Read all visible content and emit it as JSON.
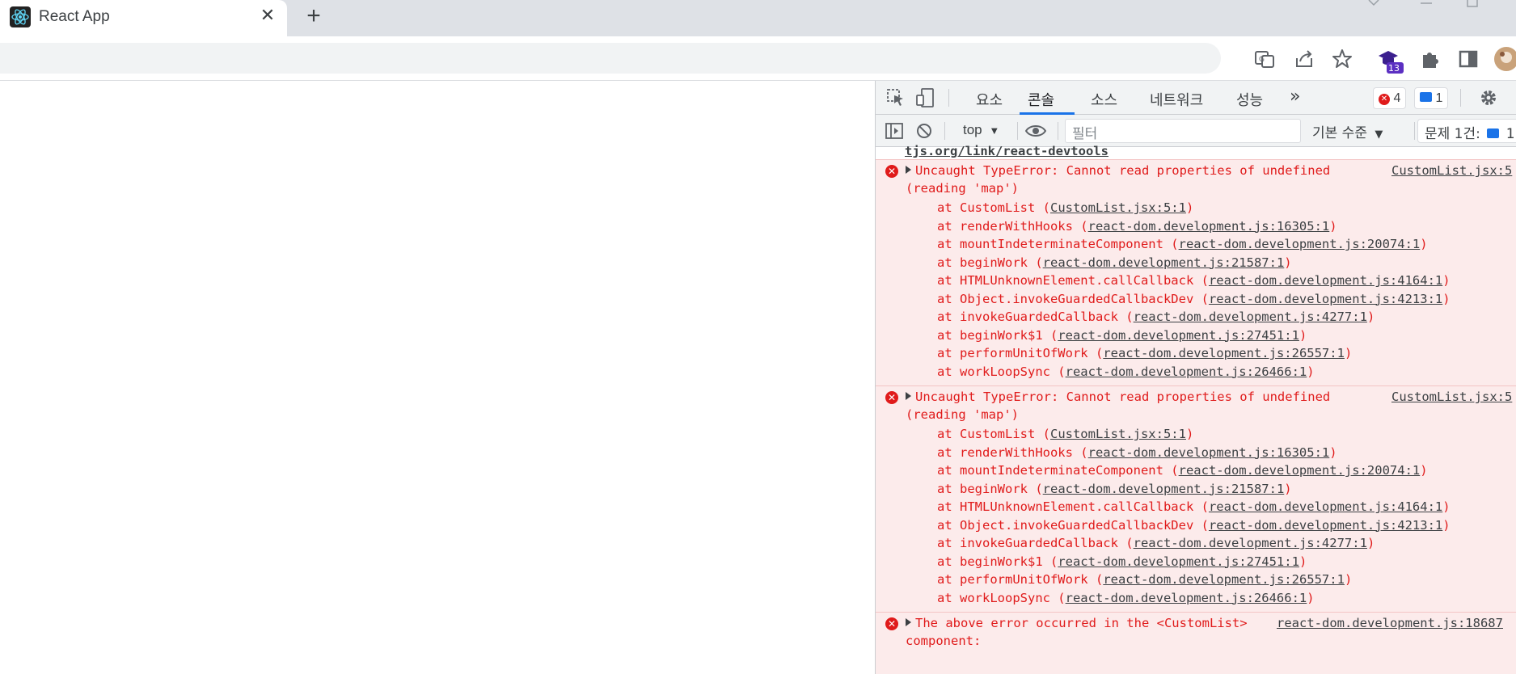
{
  "browser": {
    "tab_title": "React App",
    "new_tab_label": "+",
    "close_label": "✕",
    "extensions_badge": "13"
  },
  "devtools": {
    "tabs": [
      "요소",
      "콘솔",
      "소스",
      "네트워크",
      "성능"
    ],
    "more_tabs": "»",
    "error_count": "4",
    "message_count": "1",
    "context": "top",
    "filter_placeholder": "필터",
    "level": "기본 수준",
    "issues_label": "문제 1건:",
    "issues_count": "1"
  },
  "console": {
    "cut_line": "tjs.org/link/react-devtools",
    "errors": [
      {
        "message": "Uncaught TypeError: Cannot read properties of undefined",
        "message_cont": "(reading 'map')",
        "source": "CustomList.jsx:5",
        "stack": [
          {
            "fn": "at CustomList (",
            "loc": "CustomList.jsx:5:1",
            "end": ")"
          },
          {
            "fn": "at renderWithHooks (",
            "loc": "react-dom.development.js:16305:1",
            "end": ")"
          },
          {
            "fn": "at mountIndeterminateComponent (",
            "loc": "react-dom.development.js:20074:1",
            "end": ")"
          },
          {
            "fn": "at beginWork (",
            "loc": "react-dom.development.js:21587:1",
            "end": ")"
          },
          {
            "fn": "at HTMLUnknownElement.callCallback (",
            "loc": "react-dom.development.js:4164:1",
            "end": ")"
          },
          {
            "fn": "at Object.invokeGuardedCallbackDev (",
            "loc": "react-dom.development.js:4213:1",
            "end": ")"
          },
          {
            "fn": "at invokeGuardedCallback (",
            "loc": "react-dom.development.js:4277:1",
            "end": ")"
          },
          {
            "fn": "at beginWork$1 (",
            "loc": "react-dom.development.js:27451:1",
            "end": ")"
          },
          {
            "fn": "at performUnitOfWork (",
            "loc": "react-dom.development.js:26557:1",
            "end": ")"
          },
          {
            "fn": "at workLoopSync (",
            "loc": "react-dom.development.js:26466:1",
            "end": ")"
          }
        ]
      },
      {
        "message": "Uncaught TypeError: Cannot read properties of undefined",
        "message_cont": "(reading 'map')",
        "source": "CustomList.jsx:5",
        "stack": [
          {
            "fn": "at CustomList (",
            "loc": "CustomList.jsx:5:1",
            "end": ")"
          },
          {
            "fn": "at renderWithHooks (",
            "loc": "react-dom.development.js:16305:1",
            "end": ")"
          },
          {
            "fn": "at mountIndeterminateComponent (",
            "loc": "react-dom.development.js:20074:1",
            "end": ")"
          },
          {
            "fn": "at beginWork (",
            "loc": "react-dom.development.js:21587:1",
            "end": ")"
          },
          {
            "fn": "at HTMLUnknownElement.callCallback (",
            "loc": "react-dom.development.js:4164:1",
            "end": ")"
          },
          {
            "fn": "at Object.invokeGuardedCallbackDev (",
            "loc": "react-dom.development.js:4213:1",
            "end": ")"
          },
          {
            "fn": "at invokeGuardedCallback (",
            "loc": "react-dom.development.js:4277:1",
            "end": ")"
          },
          {
            "fn": "at beginWork$1 (",
            "loc": "react-dom.development.js:27451:1",
            "end": ")"
          },
          {
            "fn": "at performUnitOfWork (",
            "loc": "react-dom.development.js:26557:1",
            "end": ")"
          },
          {
            "fn": "at workLoopSync (",
            "loc": "react-dom.development.js:26466:1",
            "end": ")"
          }
        ]
      },
      {
        "message": "The above error occurred in the <CustomList>",
        "message_cont": "component:",
        "source": "react-dom.development.js:18687",
        "stack": []
      }
    ]
  },
  "colors": {
    "error_red": "#e01b1b",
    "error_bg": "#fcebeb",
    "accent_blue": "#1a73e8",
    "ext_badge": "#5b2fc2"
  }
}
